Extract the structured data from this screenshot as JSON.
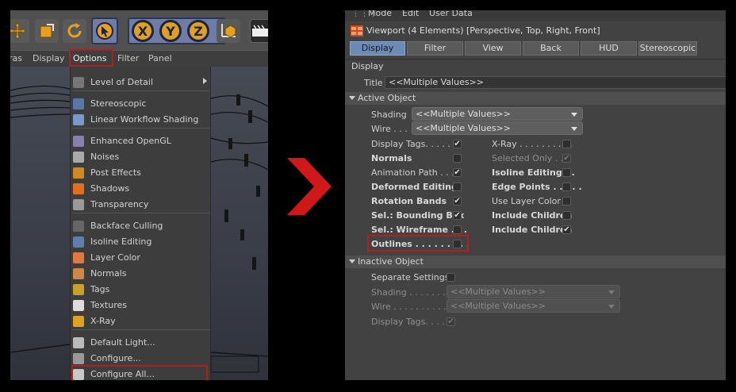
{
  "left_panel": {
    "menubar": [
      "ras",
      "Display",
      "Options",
      "Filter",
      "Panel"
    ],
    "axis_buttons": [
      "X",
      "Y",
      "Z"
    ],
    "options_menu": [
      {
        "label": "Level of Detail",
        "icon": "level-of-detail-icon",
        "submenu": true
      },
      {
        "label": "Stereoscopic",
        "icon": "stereoscopic-icon"
      },
      {
        "label": "Linear Workflow Shading",
        "icon": "linear-workflow-icon"
      },
      {
        "label": "Enhanced OpenGL",
        "icon": "enhanced-opengl-icon"
      },
      {
        "label": "Noises",
        "icon": "noises-icon"
      },
      {
        "label": "Post Effects",
        "icon": "post-effects-icon"
      },
      {
        "label": "Shadows",
        "icon": "shadows-icon"
      },
      {
        "label": "Transparency",
        "icon": "transparency-icon"
      },
      {
        "label": "Backface Culling",
        "icon": "backface-culling-icon"
      },
      {
        "label": "Isoline Editing",
        "icon": "isoline-editing-icon"
      },
      {
        "label": "Layer Color",
        "icon": "layer-color-icon"
      },
      {
        "label": "Normals",
        "icon": "normals-icon"
      },
      {
        "label": "Tags",
        "icon": "tags-icon"
      },
      {
        "label": "Textures",
        "icon": "textures-icon"
      },
      {
        "label": "X-Ray",
        "icon": "xray-icon"
      },
      {
        "label": "Default Light...",
        "icon": "default-light-icon"
      },
      {
        "label": "Configure...",
        "icon": "configure-icon"
      },
      {
        "label": "Configure All...",
        "icon": "configure-all-icon"
      }
    ]
  },
  "right_panel": {
    "top_menu": [
      "Mode",
      "Edit",
      "User Data"
    ],
    "window_title": "Viewport (4 Elements) [Perspective, Top, Right, Front]",
    "tabs": [
      "Display",
      "Filter",
      "View",
      "Back",
      "HUD",
      "Stereoscopic"
    ],
    "display_header": "Display",
    "title_label": "Title",
    "title_value": "<<Multiple Values>>",
    "active_object": {
      "header": "Active Object",
      "shading_label": "Shading",
      "shading_value": "<<Multiple Values>>",
      "wire_label": "Wire . . .",
      "wire_value": "<<Multiple Values>>",
      "left_rows": [
        {
          "label": "Display Tags. . . . . .",
          "bold": false,
          "checked": true
        },
        {
          "label": "Normals",
          "bold": true,
          "checked": false
        },
        {
          "label": "Animation Path . . .",
          "bold": false,
          "checked": true
        },
        {
          "label": "Deformed Editing",
          "bold": true,
          "checked": false
        },
        {
          "label": "Rotation Bands",
          "bold": true,
          "checked": true
        },
        {
          "label": "Sel.: Bounding Box",
          "bold": true,
          "checked": true
        },
        {
          "label": "Sel.: Wireframe . . .",
          "bold": true,
          "checked": false
        },
        {
          "label": "Outlines . . . . . . . . .",
          "bold": true,
          "checked": false
        }
      ],
      "right_rows": [
        {
          "label": "X-Ray . . . . . . . . . .",
          "bold": false,
          "checked": false,
          "dim": false
        },
        {
          "label": "Selected Only . .",
          "bold": false,
          "checked": true,
          "dim": true
        },
        {
          "label": "Isoline Editing . .",
          "bold": true,
          "checked": false,
          "dim": false
        },
        {
          "label": "Edge Points . . . . .",
          "bold": true,
          "checked": false,
          "dim": false
        },
        {
          "label": "Use Layer Color",
          "bold": false,
          "checked": false,
          "dim": false
        },
        {
          "label": "Include Children",
          "bold": true,
          "checked": false,
          "dim": false
        },
        {
          "label": "Include Children",
          "bold": true,
          "checked": true,
          "dim": false
        }
      ]
    },
    "inactive_object": {
      "header": "Inactive Object",
      "separate_settings_label": "Separate Settings",
      "shading_label": "Shading . . . . . . . .",
      "shading_value": "<<Multiple Values>>",
      "wire_label": "Wire . . . . . . . . . . .",
      "wire_value": "<<Multiple Values>>",
      "display_tags_label": "Display Tags. . . . ."
    }
  },
  "colors": {
    "highlight_red": "#b02020",
    "active_tab": "#6b8bb5",
    "arrow_red": "#d01818"
  }
}
